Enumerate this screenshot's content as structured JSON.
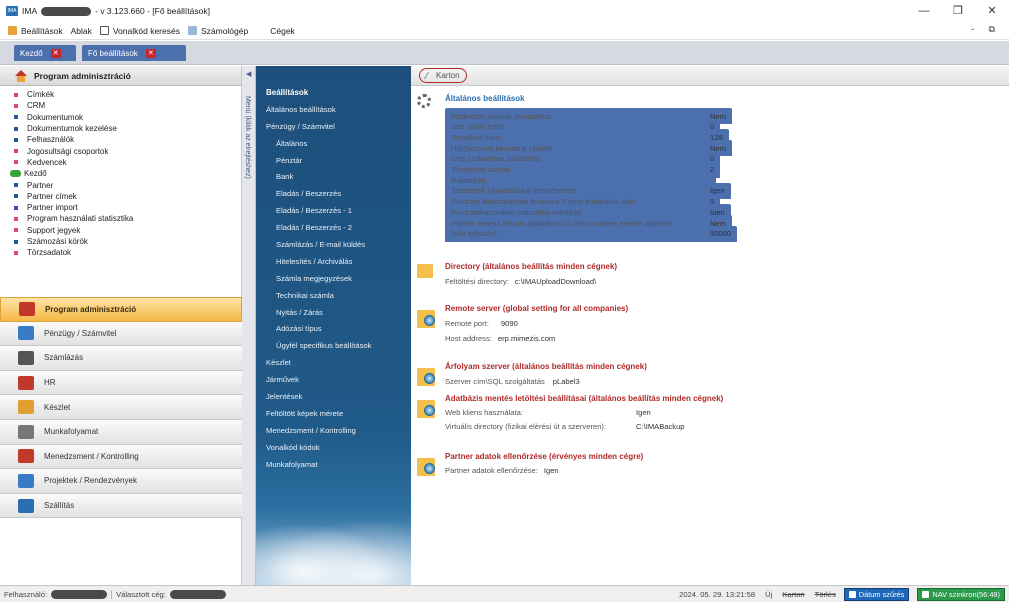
{
  "titlebar": {
    "app_name": "IMA",
    "title_suffix": "- v 3.123.660 - [Fő beállítások]",
    "min": "—",
    "max": "❐",
    "close": "✕"
  },
  "menubar": {
    "items": [
      "Beállítások",
      "Ablak",
      "Vonalkód keresés",
      "Számológép",
      "Cégek"
    ],
    "right": "- ⧉"
  },
  "tabs": [
    {
      "label": "Kezdő",
      "close": "✕"
    },
    {
      "label": "Fő beállítások",
      "close": "✕"
    }
  ],
  "left_panel": {
    "header": "Program adminisztráció",
    "tree": [
      {
        "label": "Címkék",
        "bullet": "pink"
      },
      {
        "label": "CRM",
        "bullet": "pink"
      },
      {
        "label": "Dokumentumok",
        "bullet": "blue"
      },
      {
        "label": "Dokumentumok kezelése",
        "bullet": "blue"
      },
      {
        "label": "Felhasználók",
        "bullet": "blue"
      },
      {
        "label": "Jogosultsági csoportok",
        "bullet": "pink"
      },
      {
        "label": "Kedvencek",
        "bullet": "pink"
      },
      {
        "label": "Kezdő",
        "bullet": "green"
      },
      {
        "label": "Partner",
        "bullet": "blue"
      },
      {
        "label": "Partner címek",
        "bullet": "blue"
      },
      {
        "label": "Partner import",
        "bullet": "blue"
      },
      {
        "label": "Program használati statisztika",
        "bullet": "pink"
      },
      {
        "label": "Support jegyek",
        "bullet": "pink"
      },
      {
        "label": "Számozási körök",
        "bullet": "blue"
      },
      {
        "label": "Törzsadatok",
        "bullet": "pink"
      }
    ],
    "modules": [
      {
        "label": "Program adminisztráció",
        "active": true,
        "color": "#c0392b"
      },
      {
        "label": "Pénzügy / Számvitel",
        "active": false,
        "color": "#3a7bc8"
      },
      {
        "label": "Számlázás",
        "active": false,
        "color": "#555555"
      },
      {
        "label": "HR",
        "active": false,
        "color": "#c0392b"
      },
      {
        "label": "Készlet",
        "active": false,
        "color": "#e0a030"
      },
      {
        "label": "Munkafolyamat",
        "active": false,
        "color": "#777777"
      },
      {
        "label": "Menedzsment / Kontrolling",
        "active": false,
        "color": "#c0392b"
      },
      {
        "label": "Projektek / Rendezvények",
        "active": false,
        "color": "#3a7bc8"
      },
      {
        "label": "Szállítás",
        "active": false,
        "color": "#2a6fb0"
      }
    ]
  },
  "menu_strip": {
    "label": "Menü (klikk az elrejtéshez)",
    "arrow": "◀"
  },
  "settings_nav": {
    "items": [
      {
        "label": "Beállítások",
        "level": 0,
        "head": true
      },
      {
        "label": "Általános beállítások",
        "level": 0
      },
      {
        "label": "Pénzügy / Számvitel",
        "level": 0
      },
      {
        "label": "Általános",
        "level": 1
      },
      {
        "label": "Pénztár",
        "level": 1
      },
      {
        "label": "Bank",
        "level": 1
      },
      {
        "label": "Eladás / Beszerzés",
        "level": 1
      },
      {
        "label": "Eladás / Beszerzés - 1",
        "level": 1
      },
      {
        "label": "Eladás / Beszerzés - 2",
        "level": 1
      },
      {
        "label": "Számlázás / E-mail küldés",
        "level": 1
      },
      {
        "label": "Hitelesítés / Archiválás",
        "level": 1
      },
      {
        "label": "Számla megjegyzések",
        "level": 1
      },
      {
        "label": "Technikai számla",
        "level": 1
      },
      {
        "label": "Nyitás / Zárás",
        "level": 1
      },
      {
        "label": "Adózási típus",
        "level": 1
      },
      {
        "label": "Ügyfél specifikus beállítások",
        "level": 1
      },
      {
        "label": "Készlet",
        "level": 0
      },
      {
        "label": "Járművek",
        "level": 0
      },
      {
        "label": "Jelentések",
        "level": 0
      },
      {
        "label": "Feltöltött képek mérete",
        "level": 0
      },
      {
        "label": "Menedzsment / Kontrolling",
        "level": 0
      },
      {
        "label": "Vonalkód kódok",
        "level": 0
      },
      {
        "label": "Munkafolyamat",
        "level": 0
      }
    ]
  },
  "content": {
    "toolbar_label": "Karton",
    "general": {
      "title": "Általános beállítások",
      "rows": [
        {
          "label": "Módosítás okának megadása:",
          "value": "Nem"
        },
        {
          "label": "Gps zoom érték",
          "value": "0"
        },
        {
          "label": "Vonalkód típus",
          "value": "128"
        },
        {
          "label": "Hűtőközeget kimutat a cikknél",
          "value": "Nem"
        },
        {
          "label": "Cég szabadnap százaléka",
          "value": "0"
        },
        {
          "label": "Tizedesek száma:",
          "value": "2"
        },
        {
          "label": "Raktárkód:",
          "value": ""
        },
        {
          "label": "Tizedesek kimutatása a jelentéseken",
          "value": "Igen"
        },
        {
          "label": "Program kihasználtság lezárása X perc inaktivitás után",
          "value": "5"
        },
        {
          "label": "Programhasználati statisztika mentése",
          "value": "Igen"
        },
        {
          "label": "Partner kereső felugró ablakban (10 000+ partner esetén ajánlott)",
          "value": "Nem"
        },
        {
          "label": "NAV időszűrő",
          "value": "50000"
        }
      ]
    },
    "directory": {
      "title": "Directory (általános beállítás minden cégnek)",
      "label": "Feltöltési directory:",
      "value": "c:\\IMAUploadDownload\\"
    },
    "remote": {
      "title": "Remote server (global setting for all companies)",
      "port_label": "Remote port:",
      "port_value": "9090",
      "host_label": "Host address:",
      "host_value": "erp.mimezis.com"
    },
    "arfolyam": {
      "title": "Árfolyam szerver (általános beállítás minden cégnek)",
      "label": "Szerver cím\\SQL szolgáltatás",
      "value": "pLabel3"
    },
    "backup": {
      "title": "Adatbázis mentés letöltési beállításai (általános beállítás minden cégnek)",
      "web_label": "Web kliens használata:",
      "web_value": "Igen",
      "dir_label": "Virtuális directory (fizikai elérési út a szerveren):",
      "dir_value": "C:\\IMABackup"
    },
    "partner": {
      "title": "Partner adatok ellenőrzése (érvényes minden cégre)",
      "label": "Partner adatok ellenőrzése:",
      "value": "Igen"
    }
  },
  "statusbar": {
    "user_label": "Felhasználó:",
    "company_label": "Választott cég:",
    "datetime": "2024. 05. 29. 13:21:58",
    "new": "Új",
    "karton": "Karton",
    "delete": "Törlés",
    "date_filter": "Dátum szűrés",
    "nav_sync": "NAV szinkron(56:48)"
  }
}
